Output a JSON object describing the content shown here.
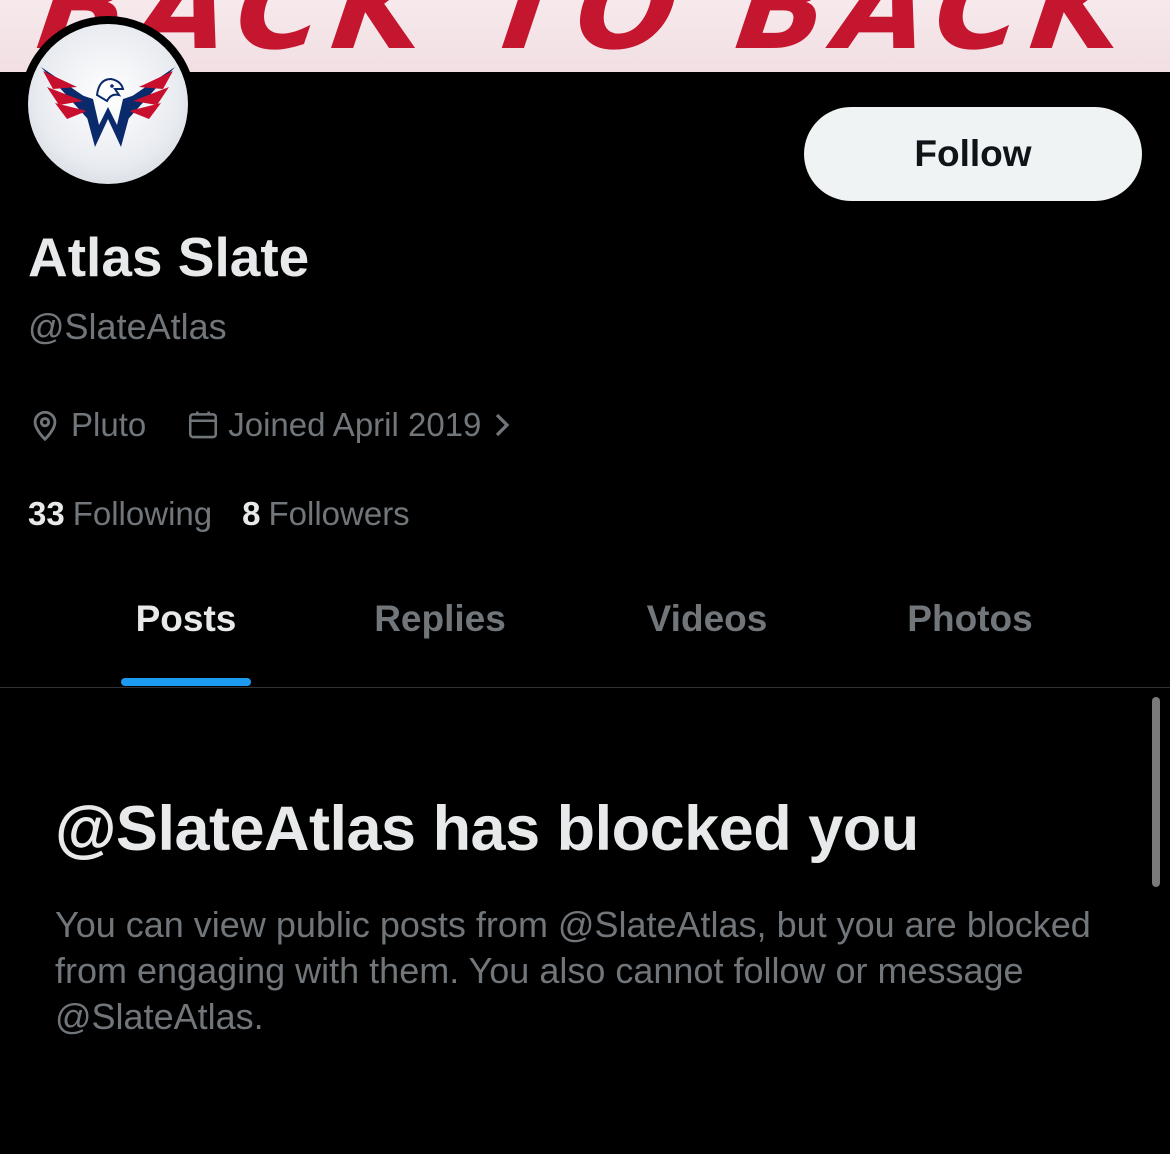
{
  "banner": {
    "text": "BACK TO BACK"
  },
  "profile": {
    "display_name": "Atlas Slate",
    "handle": "@SlateAtlas",
    "location": "Pluto",
    "joined": "Joined April 2019",
    "avatar_icon": "capitals-eagle-logo"
  },
  "actions": {
    "follow_label": "Follow"
  },
  "stats": {
    "following_count": "33",
    "following_label": "Following",
    "followers_count": "8",
    "followers_label": "Followers"
  },
  "tabs": [
    {
      "label": "Posts",
      "active": true
    },
    {
      "label": "Replies",
      "active": false
    },
    {
      "label": "Videos",
      "active": false
    },
    {
      "label": "Photos",
      "active": false
    }
  ],
  "blocked": {
    "title": "@SlateAtlas has blocked you",
    "description": "You can view public posts from @SlateAtlas, but you are blocked from engaging with them. You also cannot follow or message @SlateAtlas."
  },
  "colors": {
    "background": "#000000",
    "primary_text": "#e7e9ea",
    "secondary_text": "#71767b",
    "accent": "#1d9bf0",
    "follow_button_bg": "#eff3f4",
    "banner_text": "#c4162e"
  }
}
